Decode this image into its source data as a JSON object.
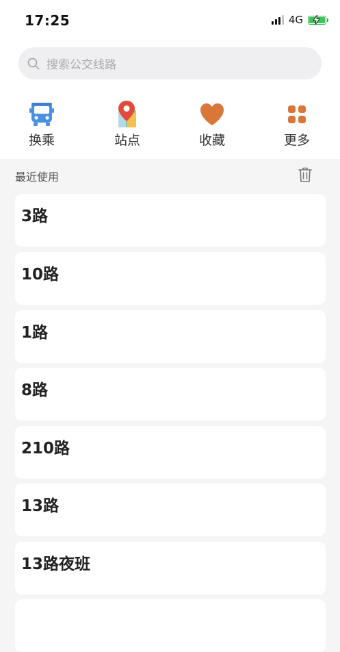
{
  "status_bar": {
    "time": "17:25",
    "network": "4G",
    "battery_level": 1.0,
    "battery_color": "#3bc45c"
  },
  "search": {
    "placeholder": "搜索公交线路",
    "icon": "search-icon"
  },
  "quick_actions": [
    {
      "label": "换乘",
      "icon": "bus-icon",
      "color": "#4a90e2"
    },
    {
      "label": "站点",
      "icon": "map-pin-icon",
      "color": "#e94b3c"
    },
    {
      "label": "收藏",
      "icon": "heart-icon",
      "color": "#d9773a"
    },
    {
      "label": "更多",
      "icon": "grid-icon",
      "color": "#d9773a"
    }
  ],
  "recent": {
    "title": "最近使用",
    "clear_icon": "trash-icon",
    "routes": [
      {
        "name": "3路"
      },
      {
        "name": "10路"
      },
      {
        "name": "1路"
      },
      {
        "name": "8路"
      },
      {
        "name": "210路"
      },
      {
        "name": "13路"
      },
      {
        "name": "13路夜班"
      }
    ]
  }
}
